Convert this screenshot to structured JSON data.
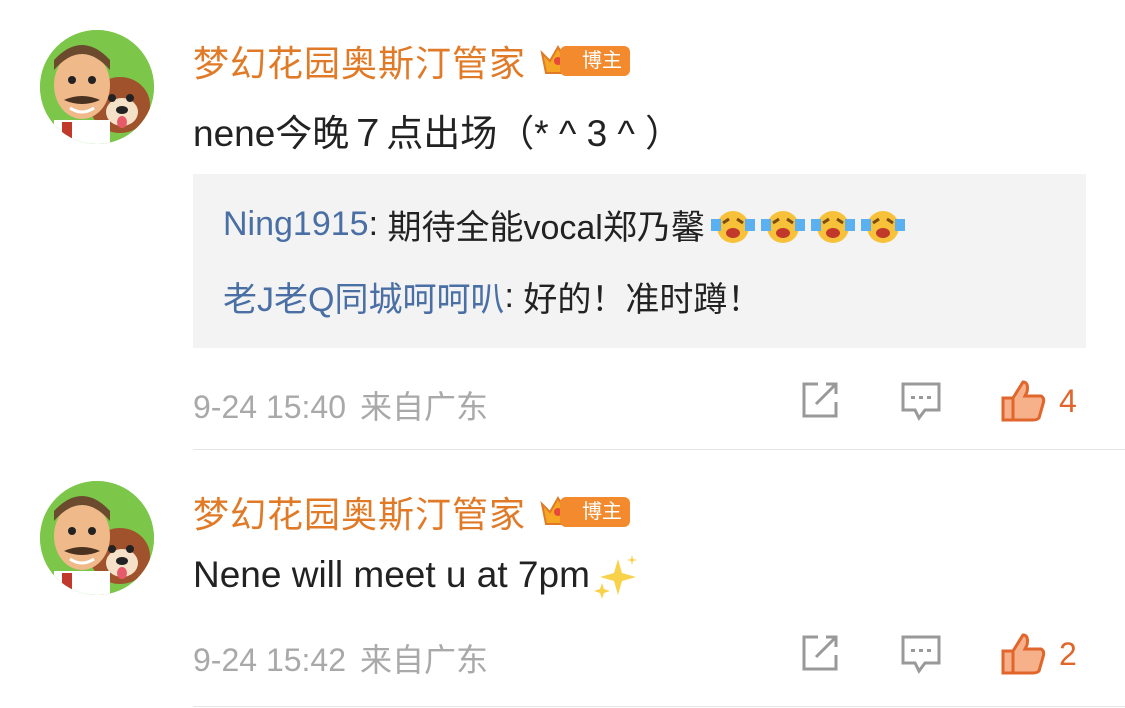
{
  "comments": [
    {
      "username": "梦幻花园奥斯汀管家",
      "badge": "博主",
      "badge_level": "6",
      "content": "nene今晚７点出场（* ^ 3 ^ ）",
      "replies": [
        {
          "user": "Ning1915",
          "sep": ": ",
          "text": "期待全能vocal郑乃馨"
        },
        {
          "user": "老J老Q同城呵呵叭",
          "sep": ": ",
          "text": "好的！准时蹲！"
        }
      ],
      "time": "9-24 15:40",
      "location": "来自广东",
      "likes": "4"
    },
    {
      "username": "梦幻花园奥斯汀管家",
      "badge": "博主",
      "badge_level": "6",
      "content": "Nene will meet u at 7pm",
      "time": "9-24 15:42",
      "location": "来自广东",
      "likes": "2"
    }
  ],
  "colors": {
    "username": "#e07a27",
    "reply_user": "#4a6fa5",
    "like": "#e0662c",
    "meta": "#a9a9a9"
  }
}
